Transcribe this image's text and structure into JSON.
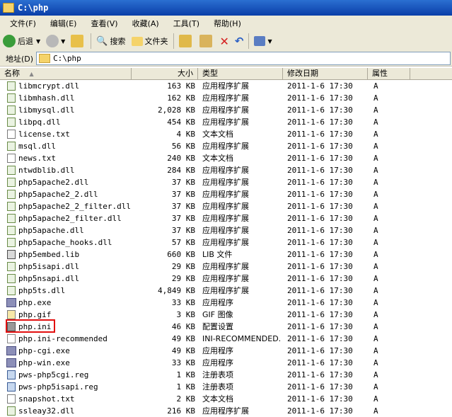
{
  "window": {
    "title": "C:\\php"
  },
  "menu": [
    "文件(F)",
    "编辑(E)",
    "查看(V)",
    "收藏(A)",
    "工具(T)",
    "帮助(H)"
  ],
  "toolbar": {
    "back": "后退",
    "search": "搜索",
    "folders": "文件夹"
  },
  "address": {
    "label": "地址(D)",
    "value": "C:\\php"
  },
  "columns": {
    "name": "名称",
    "size": "大小",
    "type": "类型",
    "modified": "修改日期",
    "attr": "属性"
  },
  "files": [
    {
      "name": "libmcrypt.dll",
      "size": "163 KB",
      "type": "应用程序扩展",
      "date": "2011-1-6 17:30",
      "attr": "A",
      "icon": "dll"
    },
    {
      "name": "libmhash.dll",
      "size": "162 KB",
      "type": "应用程序扩展",
      "date": "2011-1-6 17:30",
      "attr": "A",
      "icon": "dll"
    },
    {
      "name": "libmysql.dll",
      "size": "2,028 KB",
      "type": "应用程序扩展",
      "date": "2011-1-6 17:30",
      "attr": "A",
      "icon": "dll"
    },
    {
      "name": "libpq.dll",
      "size": "454 KB",
      "type": "应用程序扩展",
      "date": "2011-1-6 17:30",
      "attr": "A",
      "icon": "dll"
    },
    {
      "name": "license.txt",
      "size": "4 KB",
      "type": "文本文档",
      "date": "2011-1-6 17:30",
      "attr": "A",
      "icon": "txt"
    },
    {
      "name": "msql.dll",
      "size": "56 KB",
      "type": "应用程序扩展",
      "date": "2011-1-6 17:30",
      "attr": "A",
      "icon": "dll"
    },
    {
      "name": "news.txt",
      "size": "240 KB",
      "type": "文本文档",
      "date": "2011-1-6 17:30",
      "attr": "A",
      "icon": "txt"
    },
    {
      "name": "ntwdblib.dll",
      "size": "284 KB",
      "type": "应用程序扩展",
      "date": "2011-1-6 17:30",
      "attr": "A",
      "icon": "dll"
    },
    {
      "name": "php5apache2.dll",
      "size": "37 KB",
      "type": "应用程序扩展",
      "date": "2011-1-6 17:30",
      "attr": "A",
      "icon": "dll"
    },
    {
      "name": "php5apache2_2.dll",
      "size": "37 KB",
      "type": "应用程序扩展",
      "date": "2011-1-6 17:30",
      "attr": "A",
      "icon": "dll"
    },
    {
      "name": "php5apache2_2_filter.dll",
      "size": "37 KB",
      "type": "应用程序扩展",
      "date": "2011-1-6 17:30",
      "attr": "A",
      "icon": "dll"
    },
    {
      "name": "php5apache2_filter.dll",
      "size": "37 KB",
      "type": "应用程序扩展",
      "date": "2011-1-6 17:30",
      "attr": "A",
      "icon": "dll"
    },
    {
      "name": "php5apache.dll",
      "size": "37 KB",
      "type": "应用程序扩展",
      "date": "2011-1-6 17:30",
      "attr": "A",
      "icon": "dll"
    },
    {
      "name": "php5apache_hooks.dll",
      "size": "57 KB",
      "type": "应用程序扩展",
      "date": "2011-1-6 17:30",
      "attr": "A",
      "icon": "dll"
    },
    {
      "name": "php5embed.lib",
      "size": "660 KB",
      "type": "LIB 文件",
      "date": "2011-1-6 17:30",
      "attr": "A",
      "icon": "lib"
    },
    {
      "name": "php5isapi.dll",
      "size": "29 KB",
      "type": "应用程序扩展",
      "date": "2011-1-6 17:30",
      "attr": "A",
      "icon": "dll"
    },
    {
      "name": "php5nsapi.dll",
      "size": "29 KB",
      "type": "应用程序扩展",
      "date": "2011-1-6 17:30",
      "attr": "A",
      "icon": "dll"
    },
    {
      "name": "php5ts.dll",
      "size": "4,849 KB",
      "type": "应用程序扩展",
      "date": "2011-1-6 17:30",
      "attr": "A",
      "icon": "dll"
    },
    {
      "name": "php.exe",
      "size": "33 KB",
      "type": "应用程序",
      "date": "2011-1-6 17:30",
      "attr": "A",
      "icon": "exe"
    },
    {
      "name": "php.gif",
      "size": "3 KB",
      "type": "GIF 图像",
      "date": "2011-1-6 17:30",
      "attr": "A",
      "icon": "gif"
    },
    {
      "name": "php.ini",
      "size": "46 KB",
      "type": "配置设置",
      "date": "2011-1-6 17:30",
      "attr": "A",
      "icon": "ini"
    },
    {
      "name": "php.ini-recommended",
      "size": "49 KB",
      "type": "INI-RECOMMENDED...",
      "date": "2011-1-6 17:30",
      "attr": "A",
      "icon": "def"
    },
    {
      "name": "php-cgi.exe",
      "size": "49 KB",
      "type": "应用程序",
      "date": "2011-1-6 17:30",
      "attr": "A",
      "icon": "exe"
    },
    {
      "name": "php-win.exe",
      "size": "33 KB",
      "type": "应用程序",
      "date": "2011-1-6 17:30",
      "attr": "A",
      "icon": "exe"
    },
    {
      "name": "pws-php5cgi.reg",
      "size": "1 KB",
      "type": "注册表项",
      "date": "2011-1-6 17:30",
      "attr": "A",
      "icon": "reg"
    },
    {
      "name": "pws-php5isapi.reg",
      "size": "1 KB",
      "type": "注册表项",
      "date": "2011-1-6 17:30",
      "attr": "A",
      "icon": "reg"
    },
    {
      "name": "snapshot.txt",
      "size": "2 KB",
      "type": "文本文档",
      "date": "2011-1-6 17:30",
      "attr": "A",
      "icon": "txt"
    },
    {
      "name": "ssleay32.dll",
      "size": "216 KB",
      "type": "应用程序扩展",
      "date": "2011-1-6 17:30",
      "attr": "A",
      "icon": "dll"
    }
  ],
  "colors": {
    "titlebar": "#0a3ea8",
    "highlight": "#e21010",
    "chrome": "#ece9d8"
  }
}
